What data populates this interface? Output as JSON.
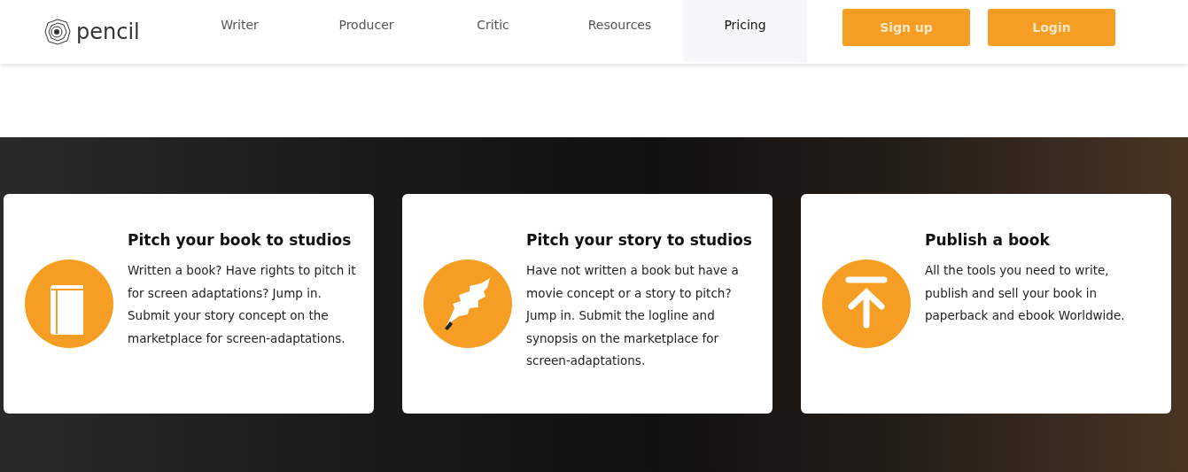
{
  "header": {
    "logo": "pencil",
    "nav": [
      {
        "label": "Writer",
        "selected": false
      },
      {
        "label": "Producer",
        "selected": false
      },
      {
        "label": "Critic",
        "selected": false
      },
      {
        "label": "Resources",
        "selected": false
      },
      {
        "label": "Pricing",
        "selected": true
      }
    ],
    "buttons": [
      "Sign up",
      "Login"
    ]
  },
  "cards": [
    {
      "kind": "book",
      "title": "Pitch your book to studios",
      "text": "Written a book? Have rights to pitch it for screen adaptations? Jump in. Submit your story concept on the marketplace for screen-adaptations."
    },
    {
      "kind": "feather",
      "title": "Pitch your story to studios",
      "text": "Have not written a book but have a movie concept or a story to pitch? Jump in. Submit the logline and synopsis on the marketplace for screen-adaptations."
    },
    {
      "kind": "upload",
      "title": "Publish a book",
      "text": "All the tools you need to write, publish and sell your book in paperback and ebook Worldwide."
    }
  ]
}
